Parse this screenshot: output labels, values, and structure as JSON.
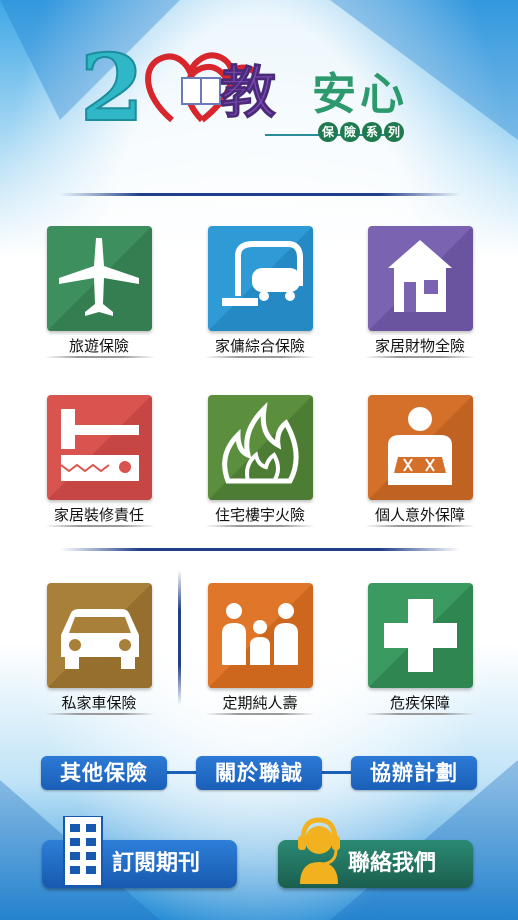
{
  "logo": {
    "number": "2",
    "char_jiao": "教",
    "text_anxin": "安心",
    "series_chars": [
      "保",
      "險",
      "系",
      "列"
    ]
  },
  "tiles": [
    {
      "label": "旅遊保險",
      "icon": "airplane-icon",
      "color": "#3e8f5e"
    },
    {
      "label": "家傭綜合保險",
      "icon": "vacuum-cleaner-icon",
      "color": "#2f9bd6"
    },
    {
      "label": "家居財物全險",
      "icon": "house-icon",
      "color": "#7a63b0"
    },
    {
      "label": "家居裝修責任",
      "icon": "hammer-saw-icon",
      "color": "#d9534f"
    },
    {
      "label": "住宅樓宇火險",
      "icon": "fire-icon",
      "color": "#5b8f3e"
    },
    {
      "label": "個人意外保障",
      "icon": "injured-person-icon",
      "color": "#d4702a"
    },
    {
      "label": "私家車保險",
      "icon": "car-icon",
      "color": "#a9803a"
    },
    {
      "label": "定期純人壽",
      "icon": "family-icon",
      "color": "#e0762a"
    },
    {
      "label": "危疾保障",
      "icon": "medical-cross-icon",
      "color": "#3a9a5f"
    }
  ],
  "links": {
    "other": "其他保險",
    "about": "關於聯誠",
    "plan": "協辦計劃"
  },
  "buttons": {
    "subscribe": "訂閱期刊",
    "contact": "聯絡我們"
  }
}
